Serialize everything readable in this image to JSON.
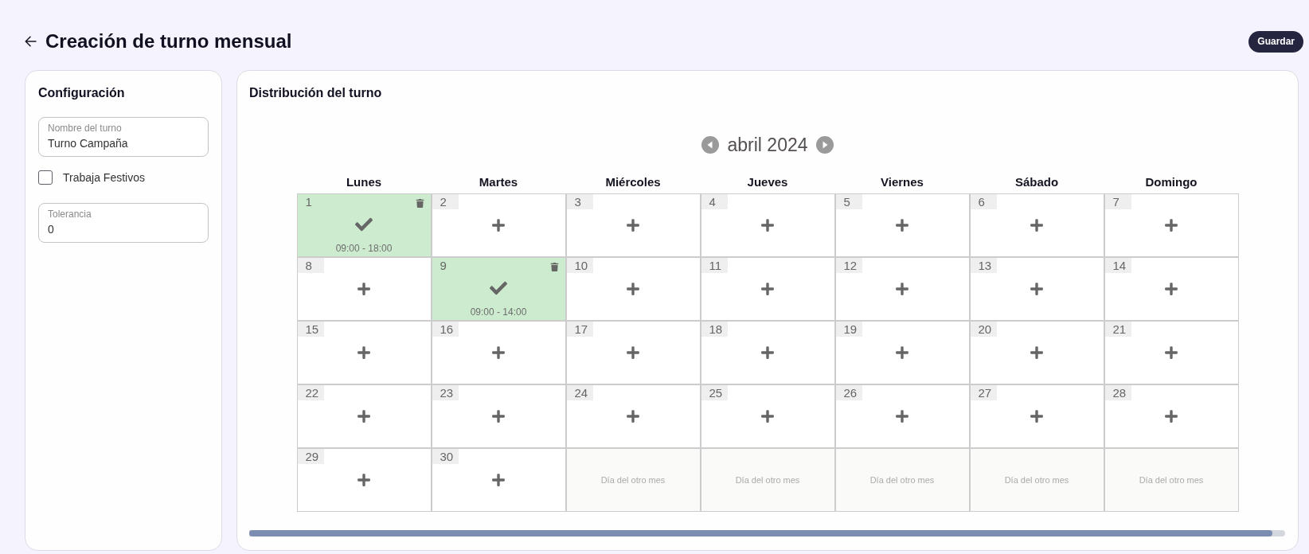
{
  "header": {
    "title": "Creación de turno mensual",
    "save_label": "Guardar"
  },
  "config": {
    "title": "Configuración",
    "controls": [
      {
        "kind": "text_field",
        "label": "Nombre del turno",
        "value": "Turno Campaña"
      },
      {
        "kind": "checkbox",
        "label": "Trabaja Festivos",
        "checked": false
      },
      {
        "kind": "text_field",
        "label": "Tolerancia",
        "value": "0"
      }
    ]
  },
  "distribution": {
    "title": "Distribución del turno",
    "month": "abril 2024",
    "weekdays": [
      "Lunes",
      "Martes",
      "Miércoles",
      "Jueves",
      "Viernes",
      "Sábado",
      "Domingo"
    ],
    "days": [
      {
        "kind": "day",
        "number": "1",
        "assigned": true,
        "hours": "09:00 - 18:00"
      },
      {
        "kind": "day",
        "number": "2",
        "assigned": false
      },
      {
        "kind": "day",
        "number": "3",
        "assigned": false
      },
      {
        "kind": "day",
        "number": "4",
        "assigned": false
      },
      {
        "kind": "day",
        "number": "5",
        "assigned": false
      },
      {
        "kind": "day",
        "number": "6",
        "assigned": false
      },
      {
        "kind": "day",
        "number": "7",
        "assigned": false
      },
      {
        "kind": "day",
        "number": "8",
        "assigned": false
      },
      {
        "kind": "day",
        "number": "9",
        "assigned": true,
        "hours": "09:00 - 14:00"
      },
      {
        "kind": "day",
        "number": "10",
        "assigned": false
      },
      {
        "kind": "day",
        "number": "11",
        "assigned": false
      },
      {
        "kind": "day",
        "number": "12",
        "assigned": false
      },
      {
        "kind": "day",
        "number": "13",
        "assigned": false
      },
      {
        "kind": "day",
        "number": "14",
        "assigned": false
      },
      {
        "kind": "day",
        "number": "15",
        "assigned": false
      },
      {
        "kind": "day",
        "number": "16",
        "assigned": false
      },
      {
        "kind": "day",
        "number": "17",
        "assigned": false
      },
      {
        "kind": "day",
        "number": "18",
        "assigned": false
      },
      {
        "kind": "day",
        "number": "19",
        "assigned": false
      },
      {
        "kind": "day",
        "number": "20",
        "assigned": false
      },
      {
        "kind": "day",
        "number": "21",
        "assigned": false
      },
      {
        "kind": "day",
        "number": "22",
        "assigned": false
      },
      {
        "kind": "day",
        "number": "23",
        "assigned": false
      },
      {
        "kind": "day",
        "number": "24",
        "assigned": false
      },
      {
        "kind": "day",
        "number": "25",
        "assigned": false
      },
      {
        "kind": "day",
        "number": "26",
        "assigned": false
      },
      {
        "kind": "day",
        "number": "27",
        "assigned": false
      },
      {
        "kind": "day",
        "number": "28",
        "assigned": false
      },
      {
        "kind": "day",
        "number": "29",
        "assigned": false
      },
      {
        "kind": "day",
        "number": "30",
        "assigned": false
      },
      {
        "kind": "other_month",
        "text": "Día del otro mes"
      },
      {
        "kind": "other_month",
        "text": "Día del otro mes"
      },
      {
        "kind": "other_month",
        "text": "Día del otro mes"
      },
      {
        "kind": "other_month",
        "text": "Día del otro mes"
      },
      {
        "kind": "other_month",
        "text": "Día del otro mes"
      }
    ]
  }
}
